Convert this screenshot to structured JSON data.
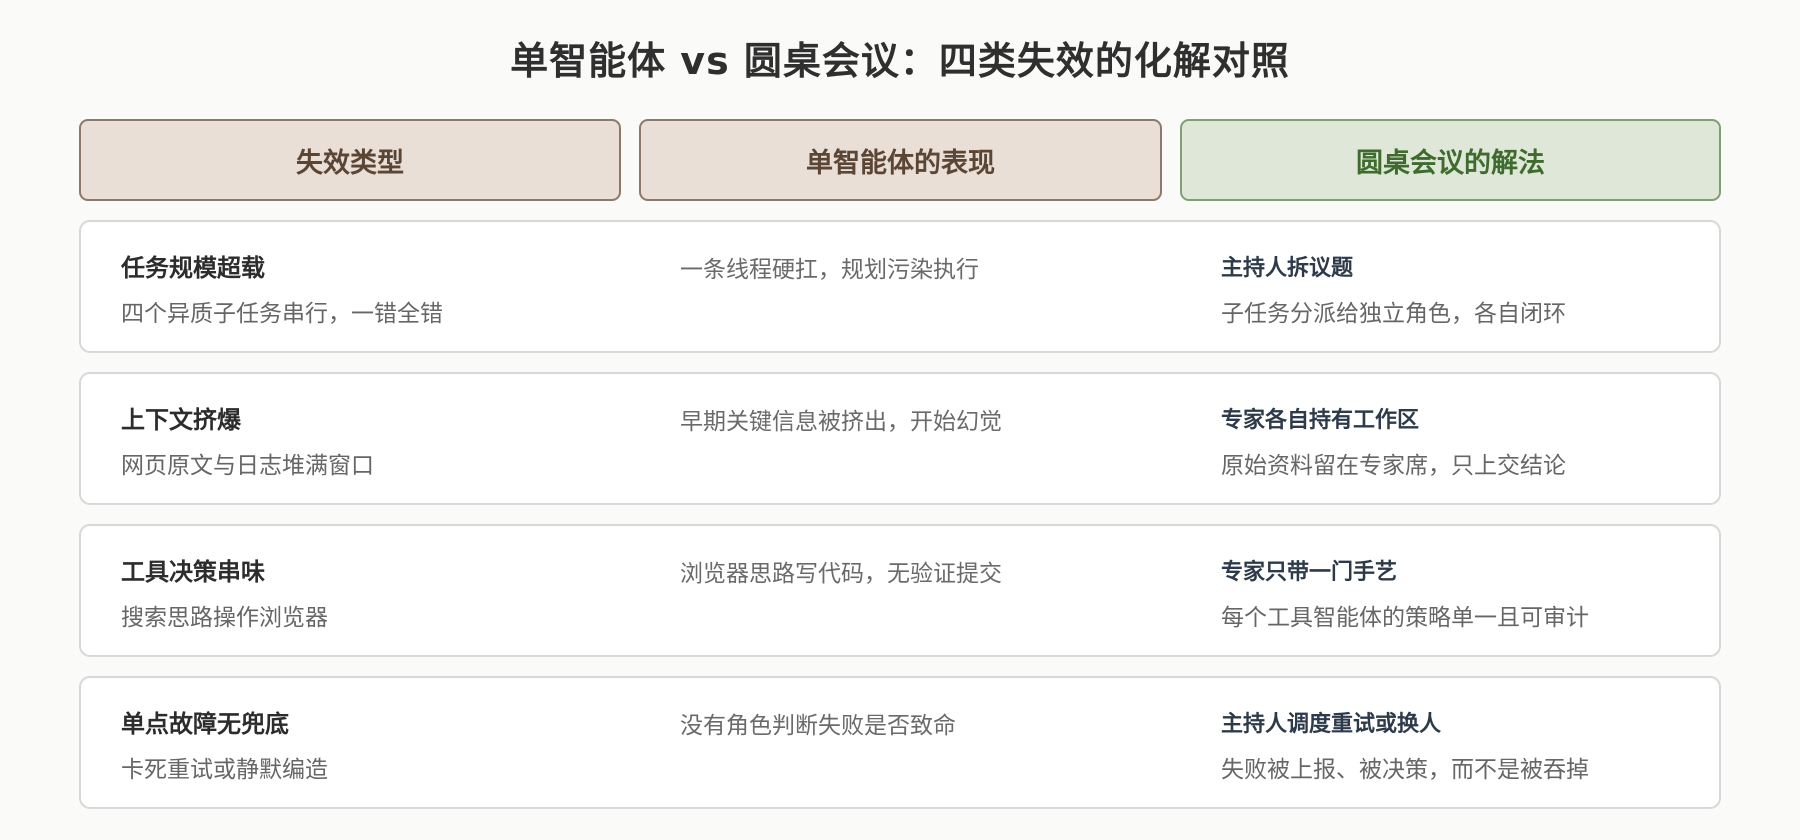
{
  "title": "单智能体 vs 圆桌会议：四类失效的化解对照",
  "headers": [
    "失效类型",
    "单智能体的表现",
    "圆桌会议的解法"
  ],
  "rows": [
    {
      "failure_title": "任务规模超载",
      "failure_desc": "四个异质子任务串行，一错全错",
      "single_agent": "一条线程硬扛，规划污染执行",
      "solution_title": "主持人拆议题",
      "solution_desc": "子任务分派给独立角色，各自闭环"
    },
    {
      "failure_title": "上下文挤爆",
      "failure_desc": "网页原文与日志堆满窗口",
      "single_agent": "早期关键信息被挤出，开始幻觉",
      "solution_title": "专家各自持有工作区",
      "solution_desc": "原始资料留在专家席，只上交结论"
    },
    {
      "failure_title": "工具决策串味",
      "failure_desc": "搜索思路操作浏览器",
      "single_agent": "浏览器思路写代码，无验证提交",
      "solution_title": "专家只带一门手艺",
      "solution_desc": "每个工具智能体的策略单一且可审计"
    },
    {
      "failure_title": "单点故障无兜底",
      "failure_desc": "卡死重试或静默编造",
      "single_agent": "没有角色判断失败是否致命",
      "solution_title": "主持人调度重试或换人",
      "solution_desc": "失败被上报、被决策，而不是被吞掉"
    }
  ]
}
